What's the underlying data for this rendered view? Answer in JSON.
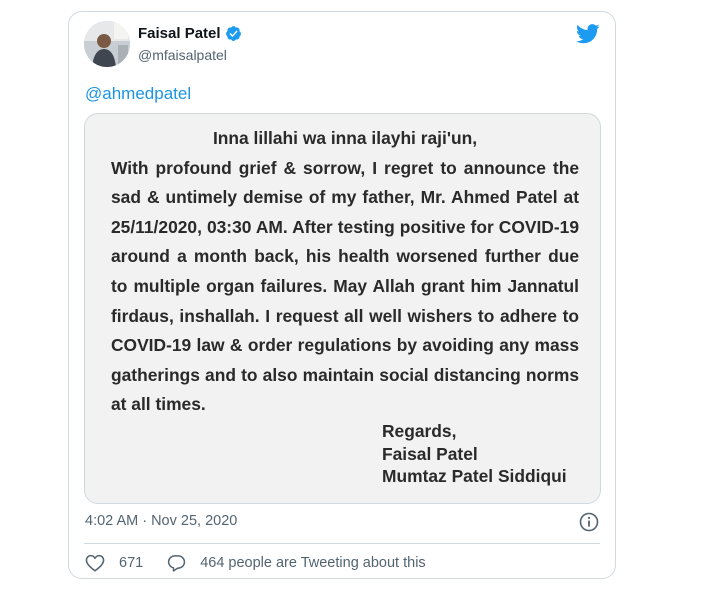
{
  "author": {
    "display_name": "Faisal Patel",
    "handle": "@mfaisalpatel",
    "verified": true
  },
  "tweet": {
    "mention": "@ahmedpatel",
    "timestamp": "4:02 AM · Nov 25, 2020"
  },
  "media": {
    "heading": "Inna lillahi wa inna ilayhi raji'un,",
    "body": "With profound grief & sorrow, I regret to announce the sad & untimely demise of my father, Mr. Ahmed Patel at 25/11/2020, 03:30 AM. After testing positive for COVID-19 around a month back, his health worsened further due to multiple organ failures. May Allah grant him Jannatul firdaus, inshallah. I request all well wishers to adhere to COVID-19 law & order regulations by avoiding any mass gatherings and to also maintain social distancing norms at all times.",
    "signoff": {
      "regards": "Regards,",
      "name1": "Faisal Patel",
      "name2": "Mumtaz Patel Siddiqui"
    }
  },
  "actions": {
    "likes": "671",
    "reply_text": "464 people are Tweeting about this"
  },
  "icons": {
    "verified": "verified-badge-icon",
    "logo": "twitter-bird-icon",
    "info": "info-icon",
    "like": "heart-icon",
    "reply": "speech-bubble-icon"
  },
  "colors": {
    "accent": "#1d9bf0",
    "link": "#1b95e0",
    "text": "#0f1419",
    "muted": "#536471",
    "border": "#cfd9de",
    "media_bg": "#f2f2f2"
  }
}
